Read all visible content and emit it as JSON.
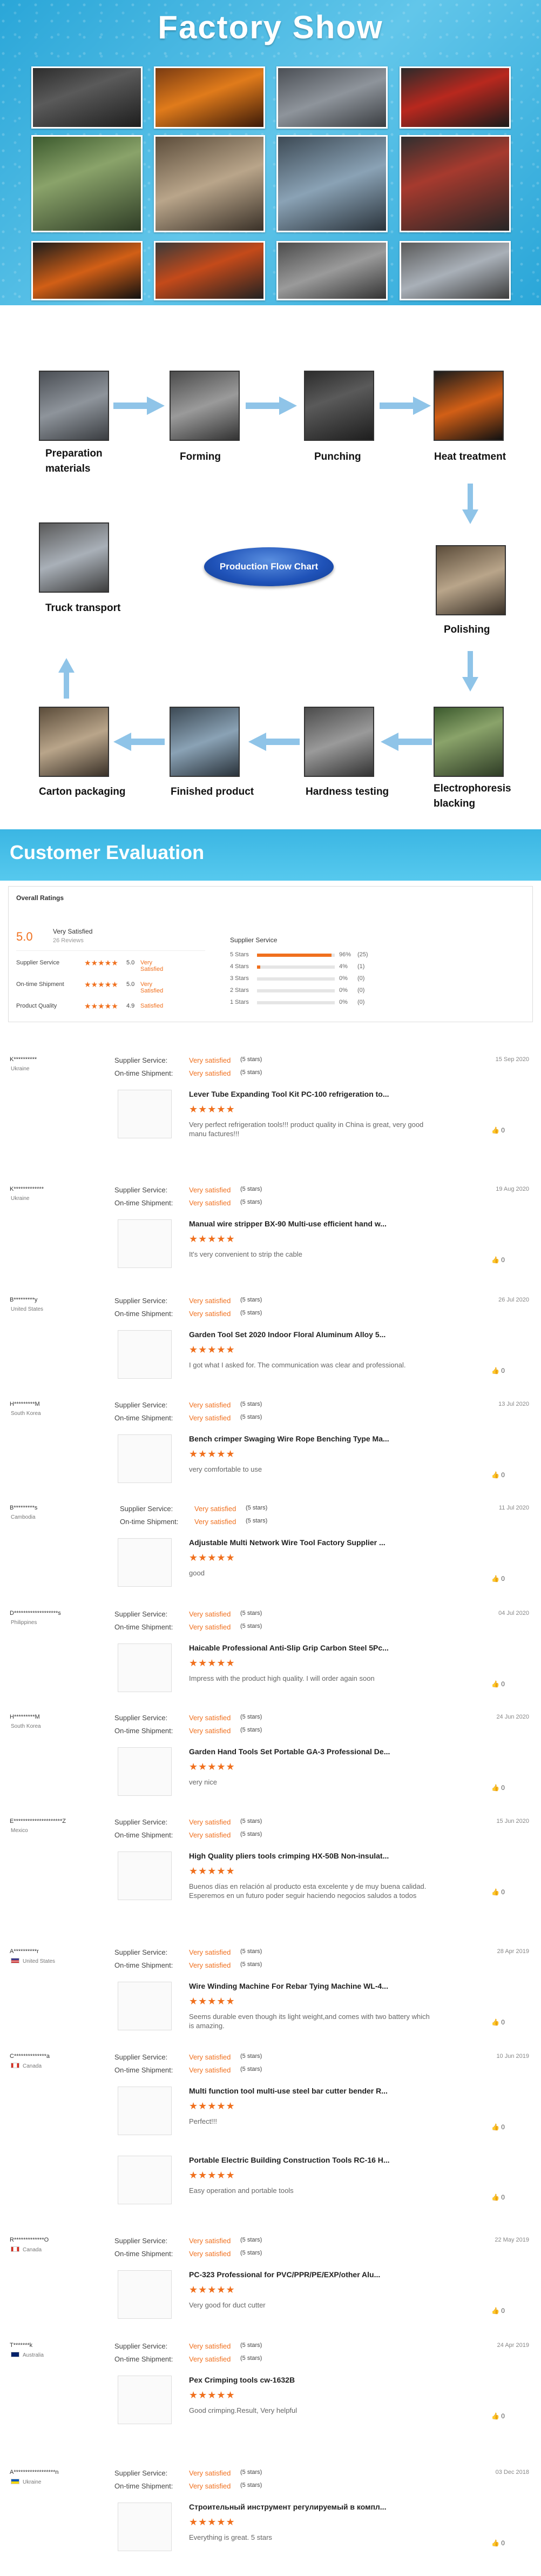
{
  "factory": {
    "title": "Factory Show"
  },
  "flow": {
    "center_label": "Production Flow Chart",
    "steps": [
      {
        "label": "Preparation materials"
      },
      {
        "label": "Forming"
      },
      {
        "label": "Punching"
      },
      {
        "label": "Heat treatment"
      },
      {
        "label": "Polishing"
      },
      {
        "label": "Electrophoresis blacking"
      },
      {
        "label": "Hardness testing"
      },
      {
        "label": "Finished product"
      },
      {
        "label": "Carton packaging"
      },
      {
        "label": "Truck transport"
      }
    ]
  },
  "evaluation": {
    "title": "Customer Evaluation",
    "overall": {
      "title": "Overall Ratings",
      "score": "5.0",
      "verdict": "Very Satisfied",
      "reviews": "26 Reviews",
      "rows": [
        {
          "label": "Supplier Service",
          "value": "5.0",
          "word": "Very Satisfied"
        },
        {
          "label": "On-time Shipment",
          "value": "5.0",
          "word": "Very Satisfied"
        },
        {
          "label": "Product Quality",
          "value": "4.9",
          "word": "Satisfied"
        }
      ],
      "distribution_title": "Supplier Service",
      "distribution": [
        {
          "label": "5 Stars",
          "pct": "96%",
          "count": "(25)",
          "fraction": 0.96
        },
        {
          "label": "4 Stars",
          "pct": "4%",
          "count": "(1)",
          "fraction": 0.04
        },
        {
          "label": "3 Stars",
          "pct": "0%",
          "count": "(0)",
          "fraction": 0
        },
        {
          "label": "2 Stars",
          "pct": "0%",
          "count": "(0)",
          "fraction": 0
        },
        {
          "label": "1 Stars",
          "pct": "0%",
          "count": "(0)",
          "fraction": 0
        }
      ]
    }
  },
  "common": {
    "supplier_service": "Supplier Service:",
    "ontime_shipment": "On-time Shipment:",
    "very_satisfied": "Very satisfied",
    "five_stars": "(5 stars)",
    "stars_glyph": "★★★★★"
  },
  "reviews": [
    {
      "name": "K**********",
      "country": "Ukraine",
      "date": "15 Sep 2020",
      "product": "Lever Tube Expanding Tool Kit PC-100 refrigeration to...",
      "comment": "Very perfect refrigeration tools!!! product quality in China is great, very good manu factures!!!",
      "likes": "0"
    },
    {
      "name": "K*************",
      "country": "Ukraine",
      "date": "19 Aug 2020",
      "product": "Manual wire stripper BX-90 Multi-use efficient hand w...",
      "comment": "It's very convenient to strip the cable",
      "likes": "0"
    },
    {
      "name": "B*********y",
      "country": "United States",
      "date": "26 Jul 2020",
      "product": "Garden Tool Set 2020 Indoor Floral Aluminum Alloy 5...",
      "comment": "I got what I asked for. The communication was clear and professional.",
      "likes": "0"
    },
    {
      "name": "H*********M",
      "country": "South Korea",
      "date": "13 Jul 2020",
      "product": "Bench crimper Swaging Wire Rope Benching Type Ma...",
      "comment": "very comfortable to use",
      "likes": "0"
    },
    {
      "name": "B*********s",
      "country": "Cambodia",
      "date": "11 Jul 2020",
      "product": "Adjustable Multi Network Wire Tool Factory Supplier ...",
      "comment": "good",
      "likes": "0"
    },
    {
      "name": "D*******************s",
      "country": "Philippines",
      "date": "04 Jul 2020",
      "product": "Haicable Professional Anti-Slip Grip Carbon Steel 5Pc...",
      "comment": "Impress with the product high quality. I will order again soon",
      "likes": "0"
    },
    {
      "name": "H*********M",
      "country": "South Korea",
      "date": "24 Jun 2020",
      "product": "Garden Hand Tools Set Portable GA-3 Professional De...",
      "comment": "very nice",
      "likes": "0"
    },
    {
      "name": "E*********************Z",
      "country": "Mexico",
      "date": "15 Jun 2020",
      "product": "High Quality pliers tools crimping HX-50B Non-insulat...",
      "comment": "Buenos días en relación al producto esta excelente y de muy buena calidad. Esperemos en un futuro poder seguir haciendo negocios saludos a todos",
      "likes": "0"
    },
    {
      "name": "A**********r",
      "country": "United States",
      "date": "28 Apr 2019",
      "product": "Wire Winding Machine For Rebar Tying Machine WL-4...",
      "comment": "Seems durable even though its light weight,and comes with two battery which is amazing.",
      "likes": "0"
    },
    {
      "name": "C**************a",
      "country": "Canada",
      "date": "10 Jun 2019",
      "product": "Multi function tool multi-use steel bar cutter bender R...",
      "comment": "Perfect!!!",
      "likes": "0"
    },
    {
      "name": "",
      "country": "",
      "date": "",
      "product": "Portable Electric Building Construction Tools RC-16 H...",
      "comment": "Easy operation and portable tools",
      "likes": "0"
    },
    {
      "name": "R*************O",
      "country": "Canada",
      "date": "22 May 2019",
      "product": "PC-323 Professional for PVC/PPR/PE/EXP/other Alu...",
      "comment": "Very good for duct cutter",
      "likes": "0"
    },
    {
      "name": "T*******k",
      "country": "Australia",
      "date": "24 Apr 2019",
      "product": "Pex Crimping tools cw-1632B",
      "comment": "Good crimping.Result, Very helpful",
      "likes": "0"
    },
    {
      "name": "A******************n",
      "country": "Ukraine",
      "date": "03 Dec 2018",
      "product": "Строительный инструмент регулируемый в компл...",
      "comment": "Everything is great. 5 stars",
      "likes": "0"
    }
  ]
}
